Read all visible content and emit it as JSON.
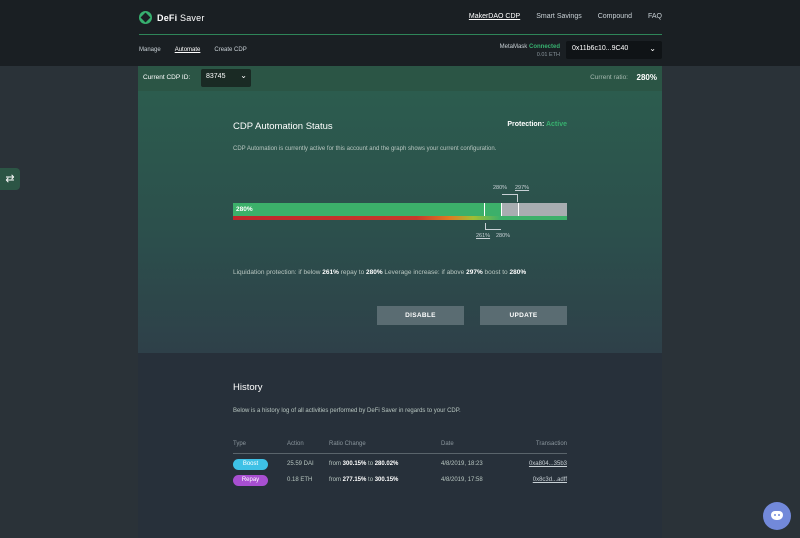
{
  "app": {
    "name_bold": "DeFi",
    "name_rest": " Saver"
  },
  "topnav": {
    "items": [
      "MakerDAO CDP",
      "Smart Savings",
      "Compound",
      "FAQ"
    ],
    "active": 0
  },
  "subnav": {
    "items": [
      "Manage",
      "Automate",
      "Create CDP"
    ],
    "active": 1
  },
  "wallet": {
    "provider": "MetaMask",
    "status": "Connected",
    "balance": "0.01 ETH",
    "address": "0x11b6c10...9C40"
  },
  "cdp": {
    "label": "Current CDP ID:",
    "id": "83745",
    "ratio_label": "Current ratio:",
    "ratio": "280%"
  },
  "automation": {
    "title": "CDP Automation Status",
    "protection_label": "Protection:",
    "protection_value": "Active",
    "description": "CDP Automation is currently active for this account and the graph shows your current configuration.",
    "bar_label": "280%",
    "top_labels": [
      "280%",
      "297%"
    ],
    "bottom_labels": [
      "261%",
      "280%"
    ],
    "summary": {
      "p1": "Liquidation protection: if below ",
      "repay_below": "261%",
      "p2": " repay to ",
      "repay_to": "280%",
      "p3": "  Leverage increase: if above ",
      "boost_above": "297%",
      "p4": " boost to ",
      "boost_to": "280%"
    },
    "disable_label": "DISABLE",
    "update_label": "UPDATE"
  },
  "history": {
    "title": "History",
    "description": "Below is a history log of all activities performed by DeFi Saver in regards to your CDP.",
    "columns": [
      "Type",
      "Action",
      "Ratio Change",
      "Date",
      "Transaction"
    ],
    "rows": [
      {
        "type": "Boost",
        "action": "25.59 DAI",
        "from_word": "from ",
        "from": "300.15%",
        "to_word": " to ",
        "to": "280.02%",
        "date": "4/8/2019, 18:23",
        "tx": "0xa804...35b3"
      },
      {
        "type": "Repay",
        "action": "0.18 ETH",
        "from_word": "from ",
        "from": "277.15%",
        "to_word": " to ",
        "to": "300.15%",
        "date": "4/8/2019, 17:58",
        "tx": "0x8c3d...adff"
      }
    ]
  },
  "colors": {
    "accent": "#37b06f",
    "boost": "#3ec1e6",
    "repay": "#a84fd1",
    "discord": "#7289da"
  },
  "icons": {
    "logo": "defi-saver-logo-icon",
    "swap": "swap-arrows-icon",
    "chat": "discord-icon",
    "chevron": "chevron-down-icon"
  }
}
